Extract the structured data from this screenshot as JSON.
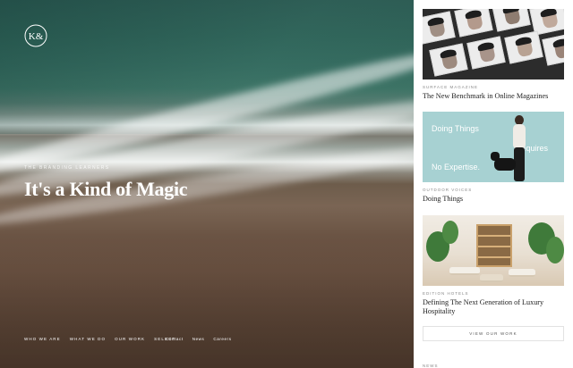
{
  "hero": {
    "logo_text": "K&",
    "eyebrow": "THE BRANDING LEARNERS",
    "headline": "It's a Kind of Magic",
    "nav_main": [
      "WHO WE ARE",
      "WHAT WE DO",
      "OUR WORK",
      "SELECT"
    ],
    "nav_sub": [
      "Contact",
      "News",
      "Careers"
    ]
  },
  "sidebar": {
    "cards": [
      {
        "kicker": "SURFACE MAGAZINE",
        "title": "The New Benchmark in Online Magazines"
      },
      {
        "kicker": "OUTDOOR VOICES",
        "title": "Doing Things",
        "ad_lines": [
          "Doing Things",
          "Requires",
          "No Expertise."
        ]
      },
      {
        "kicker": "EDITION HOTELS",
        "title": "Defining The Next Generation of Luxury Hospitality"
      }
    ],
    "view_work_label": "VIEW OUR WORK",
    "news_label": "NEWS"
  },
  "colors": {
    "ad_background": "#a7d1d2",
    "sand": "#6a5141",
    "sea": "#2f6358"
  }
}
